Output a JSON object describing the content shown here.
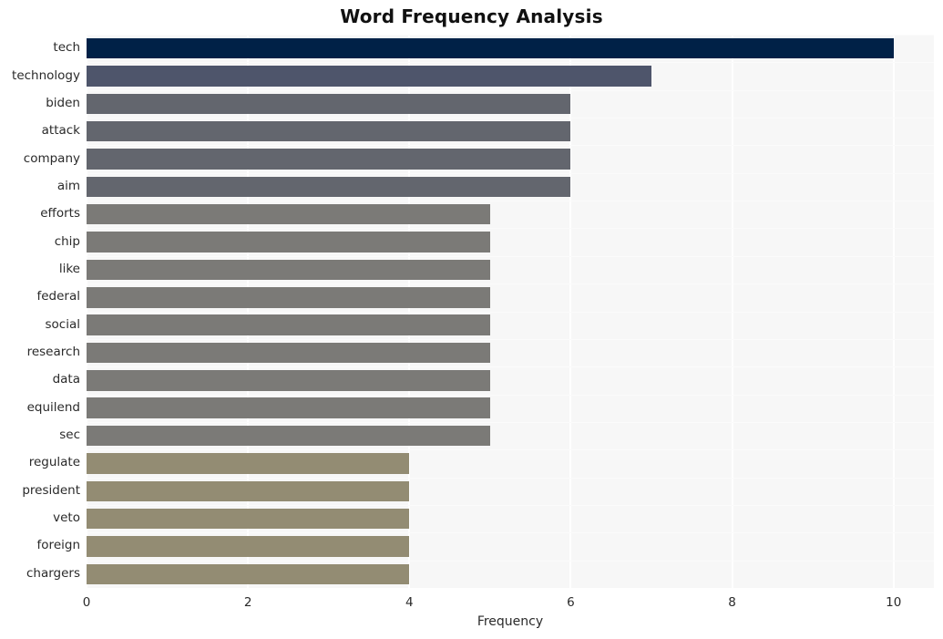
{
  "chart_data": {
    "type": "bar",
    "orientation": "horizontal",
    "title": "Word Frequency Analysis",
    "xlabel": "Frequency",
    "ylabel": "",
    "categories": [
      "tech",
      "technology",
      "biden",
      "attack",
      "company",
      "aim",
      "efforts",
      "chip",
      "like",
      "federal",
      "social",
      "research",
      "data",
      "equilend",
      "sec",
      "regulate",
      "president",
      "veto",
      "foreign",
      "chargers"
    ],
    "values": [
      10,
      7,
      6,
      6,
      6,
      6,
      5,
      5,
      5,
      5,
      5,
      5,
      5,
      5,
      5,
      4,
      4,
      4,
      4,
      4
    ],
    "bar_colors": [
      "#002147",
      "#4e556b",
      "#63666e",
      "#63666e",
      "#63666e",
      "#63666e",
      "#7b7a77",
      "#7b7a77",
      "#7b7a77",
      "#7b7a77",
      "#7b7a77",
      "#7b7a77",
      "#7b7a77",
      "#7b7a77",
      "#7b7a77",
      "#938c73",
      "#938c73",
      "#938c73",
      "#938c73",
      "#938c73"
    ],
    "xlim": [
      0,
      10.5
    ],
    "xticks": [
      0,
      2,
      4,
      6,
      8,
      10
    ],
    "xtick_labels": [
      "0",
      "2",
      "4",
      "6",
      "8",
      "10"
    ],
    "grid": true,
    "grid_axis": "both",
    "legend": "none",
    "plot_background": "#f7f7f7",
    "figure_background": "#ffffff",
    "gridline_color": "#ffffff",
    "title_color": "#111111",
    "tick_color": "#2a2a2a"
  }
}
